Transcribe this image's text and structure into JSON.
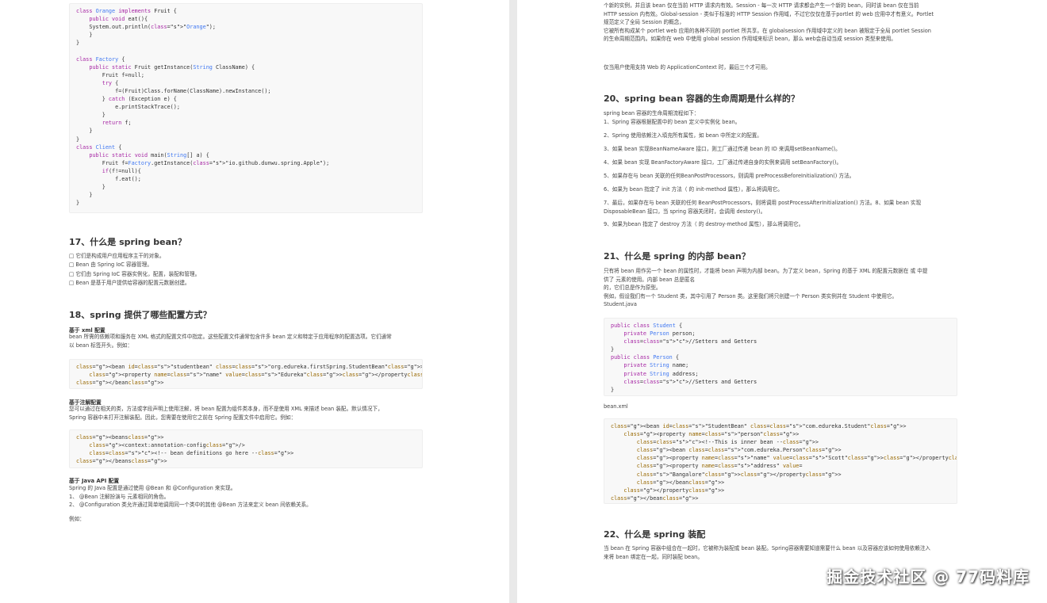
{
  "left_page": {
    "code_factory": [
      "class Orange implements Fruit {",
      "    public void eat(){",
      "    System.out.println(\"Orange\");",
      "    }",
      "}",
      "",
      "class Factory {",
      "    public static Fruit getInstance(String ClassName) {",
      "        Fruit f=null;",
      "        try {",
      "            f=(Fruit)Class.forName(ClassName).newInstance();",
      "        } catch (Exception e) {",
      "            e.printStackTrace();",
      "        }",
      "        return f;",
      "    }",
      "}",
      "class Client {",
      "    public static void main(String[] a) {",
      "        Fruit f=Factory.getInstance(\"io.github.dunwu.spring.Apple\");",
      "        if(f!=null){",
      "            f.eat();",
      "        }",
      "    }",
      "}"
    ],
    "q17_title": "17、什么是 spring bean？",
    "q17_items": [
      "□ 它们是构成用户应用程序主干的对象。",
      "□ Bean 由 Spring IoC 容器管理。",
      "□ 它们由 Spring IoC 容器实例化，配置，装配和管理。",
      "□ Bean 是基于用户提供给容器的配置元数据创建。"
    ],
    "q18_title": "18、spring 提供了哪些配置方式？",
    "xml_heading": "基于 xml 配置",
    "xml_text": [
      "bean 所需的依赖项和服务在 XML 格式的配置文件中指定。这些配置文件通常包含许多 bean 定义和特定于应用程序的配置选项。它们通常",
      "以 bean 标签开头。例如："
    ],
    "code_xml": [
      "<bean id=\"studentbean\" class=\"org.edureka.firstSpring.StudentBean\">",
      "    <property name=\"name\" value=\"Edureka\"></property>",
      "</bean>"
    ],
    "anno_heading": "基于注解配置",
    "anno_text": [
      "您可以通过在相关的类，方法或字段声明上使用注解，将 bean 配置为组件类本身，而不是使用 XML 来描述 bean 装配。默认情况下，",
      "Spring 容器中未打开注解装配。因此，您需要在使用它之前在 Spring 配置文件中启用它。例如："
    ],
    "code_anno": [
      "<beans>",
      "    <context:annotation-config/>",
      "    <!-- bean definitions go here -->",
      "</beans>"
    ],
    "java_heading": "基于 Java API 配置",
    "java_text": [
      "Spring 的 Java 配置是通过使用 @Bean 和 @Configuration 来实现。",
      "1、 @Bean 注解扮演与  元素相同的角色。",
      "2、 @Configuration 类允许通过简单地调用同一个类中的其他 @Bean 方法来定义 bean 间依赖关系。"
    ],
    "example_label": "例如："
  },
  "right_page": {
    "top_text": [
      "个新的实例，并且该 bean 仅在当前 HTTP 请求内有效。Session - 每一次 HTTP 请求都会产生一个新的 bean，同时该 bean 仅在当前",
      "HTTP session 内有效。Global-session - 类似于标准的 HTTP Session 作用域，不过它仅仅在基于portlet 的 web 应用中才有意义。Portlet",
      "规范定义了全局 Session 的概念，",
      "它被所有构成某个 portlet web 应用的各种不同的 portlet 所共享。在 globalsession 作用域中定义的 bean 被限定于全局 portlet Session",
      "的生命周期范围内。如果你在 web 中使用 global session 作用域来标识 bean，那么 web会自动当成 session 类型来使用。"
    ],
    "top_note": "仅当用户使用支持 Web 的 ApplicationContext 时，最后三个才可用。",
    "q20_title": "20、spring bean 容器的生命周期是什么样的？",
    "q20_intro": "spring bean 容器的生命周期流程如下：",
    "q20_items": [
      [
        "1、Spring 容器根据配置中的 bean 定义中实例化 bean。"
      ],
      [
        "2、Spring 使用依赖注入填充所有属性，如 bean 中所定义的配置。"
      ],
      [
        "3、如果 bean 实现BeanNameAware 接口，则工厂通过传递 bean 的 ID 来调用setBeanName()。"
      ],
      [
        "4、如果 bean 实现 BeanFactoryAware 接口，工厂通过传递自身的实例来调用 setBeanFactory()。"
      ],
      [
        "5、如果存在与 bean 关联的任何BeanPostProcessors，则调用 preProcessBeforeInitialization() 方法。"
      ],
      [
        "6、如果为 bean 指定了 init 方法（  的 init-method 属性），那么将调用它。"
      ],
      [
        "7、最后，如果存在与 bean 关联的任何 BeanPostProcessors，则将调用 postProcessAfterInitialization() 方法。8、如果 bean 实现",
        "DisposableBean 接口，当 spring 容器关闭时，会调用 destory()。"
      ],
      [
        "9、如果为bean 指定了 destroy 方法（  的 destroy-method 属性），那么将调用它。"
      ]
    ],
    "q21_title": "21、什么是 spring 的内部 bean？",
    "q21_text": [
      "只有将 bean 用作另一个 bean 的属性时，才能将 bean 声明为内部 bean。为了定义 bean，Spring 的基于 XML 的配置元数据在  或 中提",
      "供了  元素的使用。内部 bean 总是匿名",
      "的，它们总是作为原型。",
      "例如，假设我们有一个 Student 类，其中引用了 Person 类。这里我们将只创建一个 Person 类实例并在 Student 中使用它。",
      "Student.java"
    ],
    "code_student": [
      "public class Student {",
      "    private Person person;",
      "    //Setters and Getters",
      "}",
      "public class Person {",
      "    private String name;",
      "    private String address;",
      "    //Setters and Getters",
      "}"
    ],
    "beanxml_label": "bean.xml",
    "code_beanxml": [
      "<bean id=\"StudentBean\" class=\"com.edureka.Student\">",
      "    <property name=\"person\">",
      "        <!--This is inner bean -->",
      "        <bean class=\"com.edureka.Person\">",
      "        <property name=\"name\" value=\"Scott\"></property>",
      "        <property name=\"address\" value=",
      "        \"Bangalore\"></property>",
      "        </bean>",
      "    </property>",
      "</bean>"
    ],
    "q22_title": "22、什么是 spring 装配",
    "q22_text": [
      "当 bean 在 Spring 容器中组合在一起时，它被称为装配或 bean 装配。Spring容器需要知道需要什么 bean 以及容器应该如何使用依赖注入",
      "来将 bean 绑定在一起，同时装配 bean。"
    ]
  },
  "watermark": "掘金技术社区 @ 77码料库"
}
